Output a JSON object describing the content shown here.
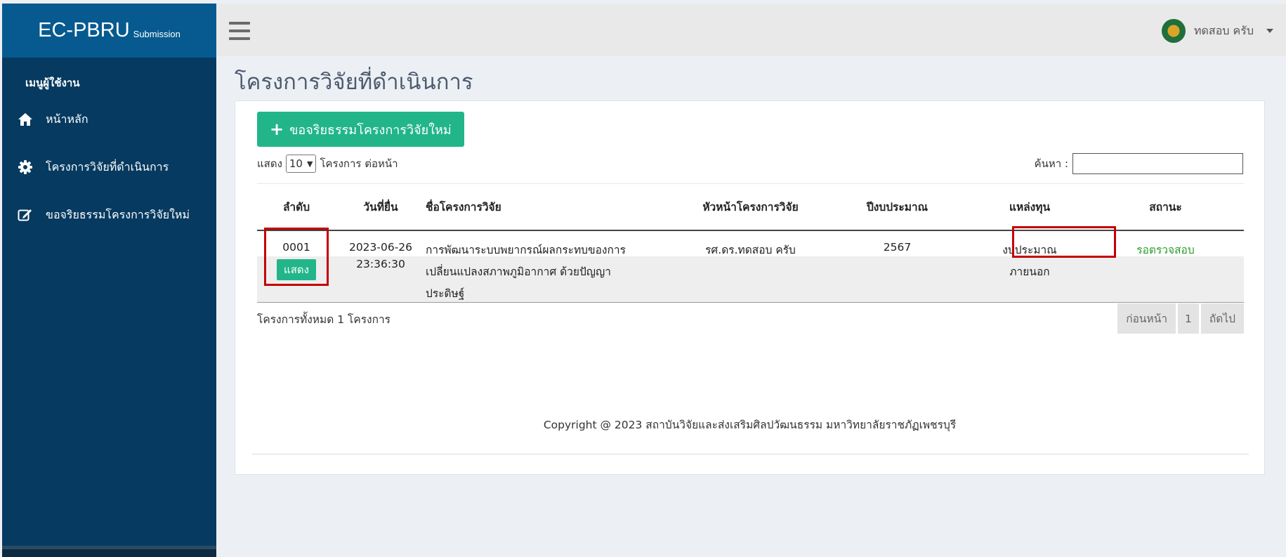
{
  "brand": {
    "main": "EC-PBRU",
    "sub": "Submission"
  },
  "sidebar": {
    "header": "เมนูผู้ใช้งาน",
    "items": [
      {
        "label": "หน้าหลัก",
        "icon": "home-icon"
      },
      {
        "label": "โครงการวิจัยที่ดำเนินการ",
        "icon": "gear-icon"
      },
      {
        "label": "ขอจริยธรรมโครงการวิจัยใหม่",
        "icon": "edit-icon"
      }
    ]
  },
  "topbar": {
    "user_name": "ทดสอบ ครับ",
    "menu_icon": "hamburger-icon"
  },
  "page": {
    "title": "โครงการวิจัยที่ดำเนินการ",
    "add_button": "ขอจริยธรรมโครงการวิจัยใหม่",
    "length": {
      "prefix": "แสดง",
      "selected": "10",
      "suffix": "โครงการ ต่อหน้า"
    },
    "search": {
      "label": "ค้นหา :",
      "value": ""
    },
    "table": {
      "headers": [
        "ลำดับ",
        "วันที่ยื่น",
        "ชื่อโครงการวิจัย",
        "หัวหน้าโครงการวิจัย",
        "ปีงบประมาณ",
        "แหล่งทุน",
        "สถานะ"
      ],
      "rows": [
        {
          "id": "0001",
          "action": "แสดง",
          "date": "2023-06-26",
          "time": "23:36:30",
          "name_l1": "การพัฒนาระบบพยากรณ์ผลกระทบของการ",
          "name_l2": "เปลี่ยนแปลงสภาพภูมิอากาศ ด้วยปัญญา",
          "name_l3": "ประดิษฐ์",
          "head": "รศ.ดร.ทดสอบ ครับ",
          "year": "2567",
          "fund_l1": "งบประมาณ",
          "fund_l2": "ภายนอก",
          "status": "รอตรวจสอบ"
        }
      ]
    },
    "info": "โครงการทั้งหมด 1 โครงการ",
    "pager": {
      "prev": "ก่อนหน้า",
      "current": "1",
      "next": "ถัดไป"
    },
    "copyright": "Copyright @ 2023 สถาบันวิจัยและส่งเสริมศิลปวัฒนธรรม มหาวิทยาลัยราชภัฏเพชรบุรี"
  },
  "colors": {
    "sidebar": "#063a60",
    "brand": "#065a8f",
    "accent": "#22b58a",
    "status": "#2b9e2b",
    "highlight": "#c40000"
  }
}
